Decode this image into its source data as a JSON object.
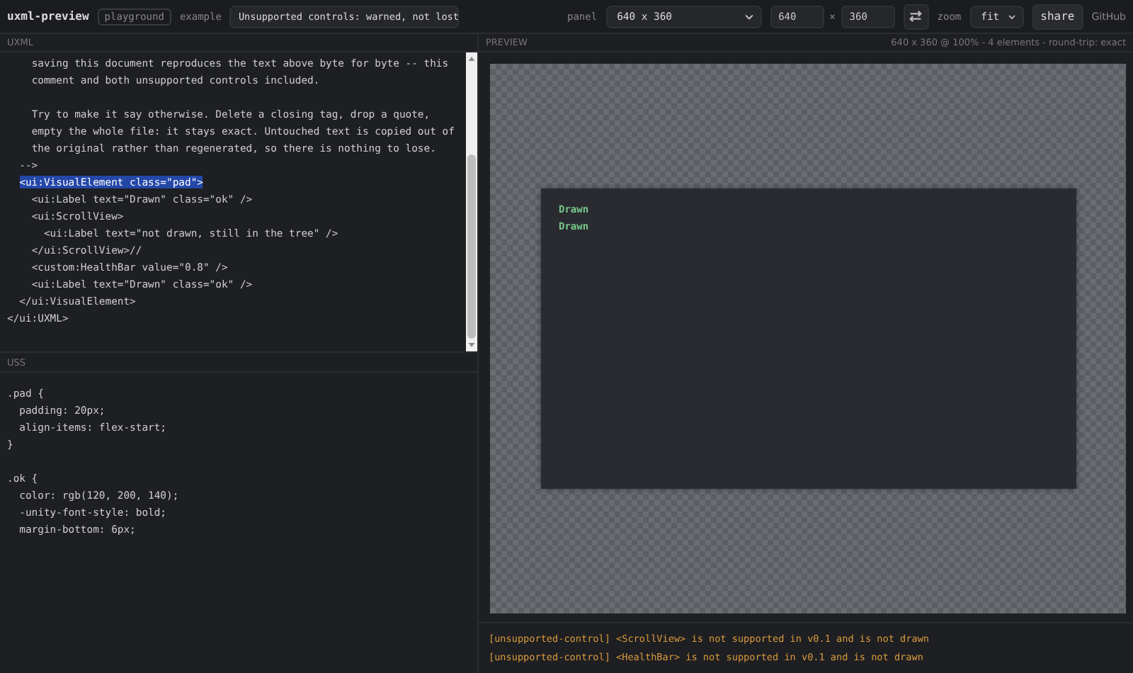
{
  "topbar": {
    "app_title": "uxml-preview",
    "badge": "playground",
    "example_label": "example",
    "example_select": "Unsupported controls: warned, not lost",
    "panel_label": "panel",
    "panel_select": "640 x 360",
    "width_value": "640",
    "times": "×",
    "height_value": "360",
    "zoom_label": "zoom",
    "zoom_select": "fit",
    "share_button": "share",
    "github_link": "GitHub"
  },
  "uxml": {
    "header": "UXML",
    "lines": [
      {
        "kind": "code",
        "text": "    saving this document reproduces the text above byte for byte -- this",
        "selected": false
      },
      {
        "kind": "code",
        "text": "    comment and both unsupported controls included.",
        "selected": false
      },
      {
        "kind": "blank"
      },
      {
        "kind": "code",
        "text": "    Try to make it say otherwise. Delete a closing tag, drop a quote,",
        "selected": false
      },
      {
        "kind": "code",
        "text": "    empty the whole file: it stays exact. Untouched text is copied out of",
        "selected": false
      },
      {
        "kind": "code",
        "text": "    the original rather than regenerated, so there is nothing to lose.",
        "selected": false
      },
      {
        "kind": "code",
        "text": "  -->",
        "selected": false
      },
      {
        "kind": "code",
        "text": "  <ui:VisualElement class=\"pad\">",
        "selected": true
      },
      {
        "kind": "code",
        "text": "    <ui:Label text=\"Drawn\" class=\"ok\" />",
        "selected": false
      },
      {
        "kind": "code",
        "text": "    <ui:ScrollView>",
        "selected": false
      },
      {
        "kind": "code",
        "text": "      <ui:Label text=\"not drawn, still in the tree\" />",
        "selected": false
      },
      {
        "kind": "code",
        "text": "    </ui:ScrollView>//",
        "selected": false
      },
      {
        "kind": "code",
        "text": "    <custom:HealthBar value=\"0.8\" />",
        "selected": false
      },
      {
        "kind": "code",
        "text": "    <ui:Label text=\"Drawn\" class=\"ok\" />",
        "selected": false
      },
      {
        "kind": "code",
        "text": "  </ui:VisualElement>",
        "selected": false
      },
      {
        "kind": "code",
        "text": "</ui:UXML>",
        "selected": false
      }
    ]
  },
  "uss": {
    "header": "USS",
    "lines": [
      {
        "kind": "code",
        "text": ".pad {"
      },
      {
        "kind": "code",
        "text": "  padding: 20px;"
      },
      {
        "kind": "code",
        "text": "  align-items: flex-start;"
      },
      {
        "kind": "code",
        "text": "}"
      },
      {
        "kind": "blank"
      },
      {
        "kind": "code",
        "text": ".ok {"
      },
      {
        "kind": "code",
        "text": "  color: rgb(120, 200, 140);"
      },
      {
        "kind": "code",
        "text": "  -unity-font-style: bold;"
      },
      {
        "kind": "code",
        "text": "  margin-bottom: 6px;"
      }
    ]
  },
  "preview": {
    "header": "PREVIEW",
    "status": "640 x 360 @ 100% - 4 elements - round-trip: exact",
    "labels": [
      {
        "text": "Drawn",
        "kind": "ok"
      },
      {
        "text": "Drawn",
        "kind": "ok"
      }
    ]
  },
  "log": [
    {
      "kind": "warning",
      "text": "[unsupported-control] <ScrollView> is not supported in v0.1 and is not drawn"
    },
    {
      "kind": "warning",
      "text": "[unsupported-control] <HealthBar> is not supported in v0.1 and is not drawn"
    }
  ]
}
